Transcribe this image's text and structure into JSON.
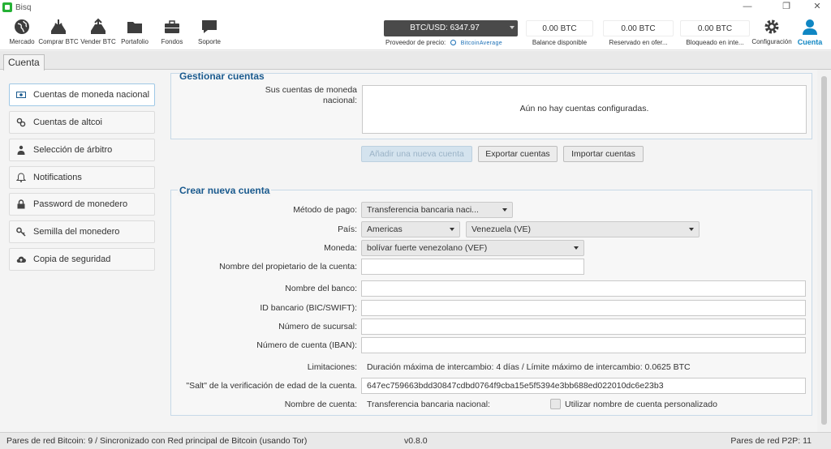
{
  "window": {
    "title": "Bisq",
    "controls": {
      "minimize": "—",
      "maximize": "❐",
      "close": "✕"
    }
  },
  "nav": {
    "items": [
      {
        "label": "Mercado",
        "icon": "globe-icon"
      },
      {
        "label": "Comprar BTC",
        "icon": "buy-btc-icon"
      },
      {
        "label": "Vender BTC",
        "icon": "sell-btc-icon"
      },
      {
        "label": "Portafolio",
        "icon": "folder-icon"
      },
      {
        "label": "Fondos",
        "icon": "briefcase-icon"
      },
      {
        "label": "Soporte",
        "icon": "chat-icon"
      }
    ],
    "price": {
      "value": "BTC/USD: 6347.97",
      "provider_label": "Proveedor de precio:",
      "provider_name": "BitcoinAverage"
    },
    "balances": [
      {
        "amount": "0.00 BTC",
        "caption": "Balance disponible"
      },
      {
        "amount": "0.00 BTC",
        "caption": "Reservado en ofer..."
      },
      {
        "amount": "0.00 BTC",
        "caption": "Bloqueado en inte..."
      }
    ],
    "settings": {
      "label": "Configuración",
      "icon": "gear-icon"
    },
    "account": {
      "label": "Cuenta",
      "icon": "user-icon",
      "active": true
    }
  },
  "tab": {
    "label": "Cuenta"
  },
  "sidebar": {
    "items": [
      {
        "label": "Cuentas de moneda nacional",
        "icon": "banknote-icon",
        "active": true
      },
      {
        "label": "Cuentas de altcoi",
        "icon": "link-icon"
      },
      {
        "label": "Selección de árbitro",
        "icon": "arbitrator-icon"
      },
      {
        "label": "Notifications",
        "icon": "bell-icon"
      },
      {
        "label": "Password de monedero",
        "icon": "lock-icon"
      },
      {
        "label": "Semilla del monedero",
        "icon": "key-icon"
      },
      {
        "label": "Copia de seguridad",
        "icon": "cloud-upload-icon"
      }
    ]
  },
  "manage": {
    "title": "Gestionar cuentas",
    "accounts_label_line1": "Sus cuentas de moneda",
    "accounts_label_line2": "nacional:",
    "empty_text": "Aún no hay cuentas configuradas.",
    "buttons": {
      "add": "Añadir una nueva cuenta",
      "export": "Exportar cuentas",
      "import": "Importar cuentas"
    }
  },
  "create": {
    "title": "Crear nueva cuenta",
    "payment_method": {
      "label": "Método de pago:",
      "value": "Transferencia bancaria naci..."
    },
    "country": {
      "label": "País:",
      "region": "Americas",
      "value": "Venezuela (VE)"
    },
    "currency": {
      "label": "Moneda:",
      "value": "bolívar fuerte venezolano (VEF)"
    },
    "owner_name": {
      "label": "Nombre del propietario de la cuenta:",
      "value": ""
    },
    "bank_name": {
      "label": "Nombre del banco:",
      "value": ""
    },
    "bank_id": {
      "label": "ID bancario (BIC/SWIFT):",
      "value": ""
    },
    "branch": {
      "label": "Número de sucursal:",
      "value": ""
    },
    "account_number": {
      "label": "Número de cuenta (IBAN):",
      "value": ""
    },
    "limits": {
      "label": "Limitaciones:",
      "value": "Duración máxima de intercambio: 4 días / Límite máximo de intercambio: 0.0625 BTC"
    },
    "salt": {
      "label": "\"Salt\" de la verificación de edad de la cuenta.",
      "value": "647ec759663bdd30847cdbd0764f9cba15e5f5394e3bb688ed022010dc6e23b3"
    },
    "account_name": {
      "label": "Nombre de cuenta:",
      "value": "Transferencia bancaria nacional:",
      "custom_label": "Utilizar nombre de cuenta personalizado",
      "custom_checked": false
    }
  },
  "status": {
    "network": "Pares de red Bitcoin: 9 / Sincronizado con Red principal de Bitcoin (usando Tor)",
    "version": "v0.8.0",
    "p2p": "Pares de red P2P: 11"
  },
  "colors": {
    "accent": "#0f86c3",
    "bisq_green": "#25b135",
    "panel_title": "#1a5a8e"
  }
}
